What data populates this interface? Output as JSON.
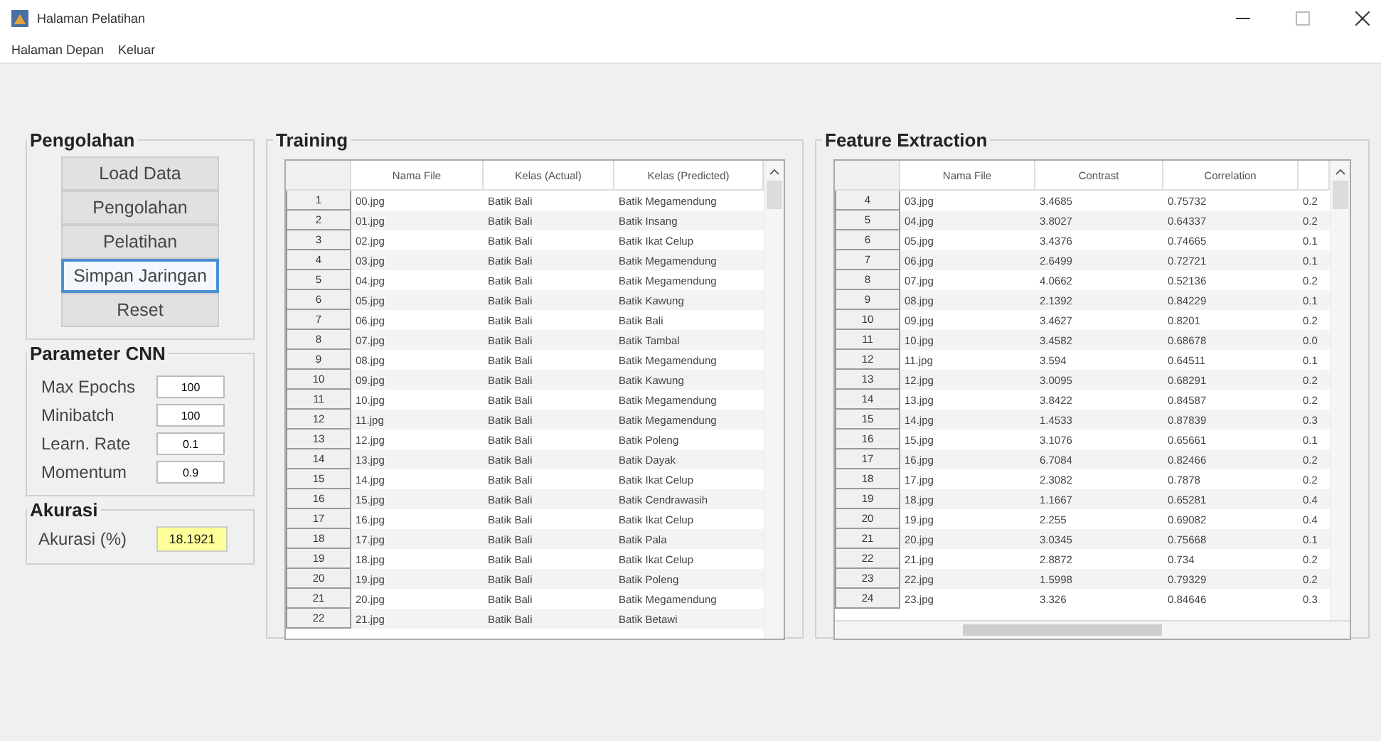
{
  "window": {
    "title": "Halaman Pelatihan"
  },
  "menu": [
    "Halaman Depan",
    "Keluar"
  ],
  "pengolahan": {
    "title": "Pengolahan",
    "buttons": [
      {
        "label": "Load Data",
        "focused": false
      },
      {
        "label": "Pengolahan",
        "focused": false
      },
      {
        "label": "Pelatihan",
        "focused": false
      },
      {
        "label": "Simpan Jaringan",
        "focused": true
      },
      {
        "label": "Reset",
        "focused": false
      }
    ]
  },
  "parameter": {
    "title": "Parameter CNN",
    "fields": [
      {
        "label": "Max Epochs",
        "value": "100"
      },
      {
        "label": "Minibatch",
        "value": "100"
      },
      {
        "label": "Learn. Rate",
        "value": "0.1"
      },
      {
        "label": "Momentum",
        "value": "0.9"
      }
    ]
  },
  "akurasi": {
    "title": "Akurasi",
    "label": "Akurasi (%)",
    "value": "18.1921"
  },
  "training": {
    "title": "Training",
    "columns": [
      "Nama File",
      "Kelas (Actual)",
      "Kelas (Predicted)"
    ],
    "rows": [
      [
        "1",
        "00.jpg",
        "Batik Bali",
        "Batik Megamendung"
      ],
      [
        "2",
        "01.jpg",
        "Batik Bali",
        "Batik Insang"
      ],
      [
        "3",
        "02.jpg",
        "Batik Bali",
        "Batik Ikat Celup"
      ],
      [
        "4",
        "03.jpg",
        "Batik Bali",
        "Batik Megamendung"
      ],
      [
        "5",
        "04.jpg",
        "Batik Bali",
        "Batik Megamendung"
      ],
      [
        "6",
        "05.jpg",
        "Batik Bali",
        "Batik Kawung"
      ],
      [
        "7",
        "06.jpg",
        "Batik Bali",
        "Batik Bali"
      ],
      [
        "8",
        "07.jpg",
        "Batik Bali",
        "Batik Tambal"
      ],
      [
        "9",
        "08.jpg",
        "Batik Bali",
        "Batik Megamendung"
      ],
      [
        "10",
        "09.jpg",
        "Batik Bali",
        "Batik Kawung"
      ],
      [
        "11",
        "10.jpg",
        "Batik Bali",
        "Batik Megamendung"
      ],
      [
        "12",
        "11.jpg",
        "Batik Bali",
        "Batik Megamendung"
      ],
      [
        "13",
        "12.jpg",
        "Batik Bali",
        "Batik Poleng"
      ],
      [
        "14",
        "13.jpg",
        "Batik Bali",
        "Batik Dayak"
      ],
      [
        "15",
        "14.jpg",
        "Batik Bali",
        "Batik Ikat Celup"
      ],
      [
        "16",
        "15.jpg",
        "Batik Bali",
        "Batik Cendrawasih"
      ],
      [
        "17",
        "16.jpg",
        "Batik Bali",
        "Batik Ikat Celup"
      ],
      [
        "18",
        "17.jpg",
        "Batik Bali",
        "Batik Pala"
      ],
      [
        "19",
        "18.jpg",
        "Batik Bali",
        "Batik Ikat Celup"
      ],
      [
        "20",
        "19.jpg",
        "Batik Bali",
        "Batik Poleng"
      ],
      [
        "21",
        "20.jpg",
        "Batik Bali",
        "Batik Megamendung"
      ],
      [
        "22",
        "21.jpg",
        "Batik Bali",
        "Batik Betawi"
      ]
    ]
  },
  "features": {
    "title": "Feature Extraction",
    "columns": [
      "Nama File",
      "Contrast",
      "Correlation"
    ],
    "rows": [
      [
        "4",
        "03.jpg",
        "3.4685",
        "0.75732",
        "0.2"
      ],
      [
        "5",
        "04.jpg",
        "3.8027",
        "0.64337",
        "0.2"
      ],
      [
        "6",
        "05.jpg",
        "3.4376",
        "0.74665",
        "0.1"
      ],
      [
        "7",
        "06.jpg",
        "2.6499",
        "0.72721",
        "0.1"
      ],
      [
        "8",
        "07.jpg",
        "4.0662",
        "0.52136",
        "0.2"
      ],
      [
        "9",
        "08.jpg",
        "2.1392",
        "0.84229",
        "0.1"
      ],
      [
        "10",
        "09.jpg",
        "3.4627",
        "0.8201",
        "0.2"
      ],
      [
        "11",
        "10.jpg",
        "3.4582",
        "0.68678",
        "0.0"
      ],
      [
        "12",
        "11.jpg",
        "3.594",
        "0.64511",
        "0.1"
      ],
      [
        "13",
        "12.jpg",
        "3.0095",
        "0.68291",
        "0.2"
      ],
      [
        "14",
        "13.jpg",
        "3.8422",
        "0.84587",
        "0.2"
      ],
      [
        "15",
        "14.jpg",
        "1.4533",
        "0.87839",
        "0.3"
      ],
      [
        "16",
        "15.jpg",
        "3.1076",
        "0.65661",
        "0.1"
      ],
      [
        "17",
        "16.jpg",
        "6.7084",
        "0.82466",
        "0.2"
      ],
      [
        "18",
        "17.jpg",
        "2.3082",
        "0.7878",
        "0.2"
      ],
      [
        "19",
        "18.jpg",
        "1.1667",
        "0.65281",
        "0.4"
      ],
      [
        "20",
        "19.jpg",
        "2.255",
        "0.69082",
        "0.4"
      ],
      [
        "21",
        "20.jpg",
        "3.0345",
        "0.75668",
        "0.1"
      ],
      [
        "22",
        "21.jpg",
        "2.8872",
        "0.734",
        "0.2"
      ],
      [
        "23",
        "22.jpg",
        "1.5998",
        "0.79329",
        "0.2"
      ],
      [
        "24",
        "23.jpg",
        "3.326",
        "0.84646",
        "0.3"
      ]
    ]
  }
}
